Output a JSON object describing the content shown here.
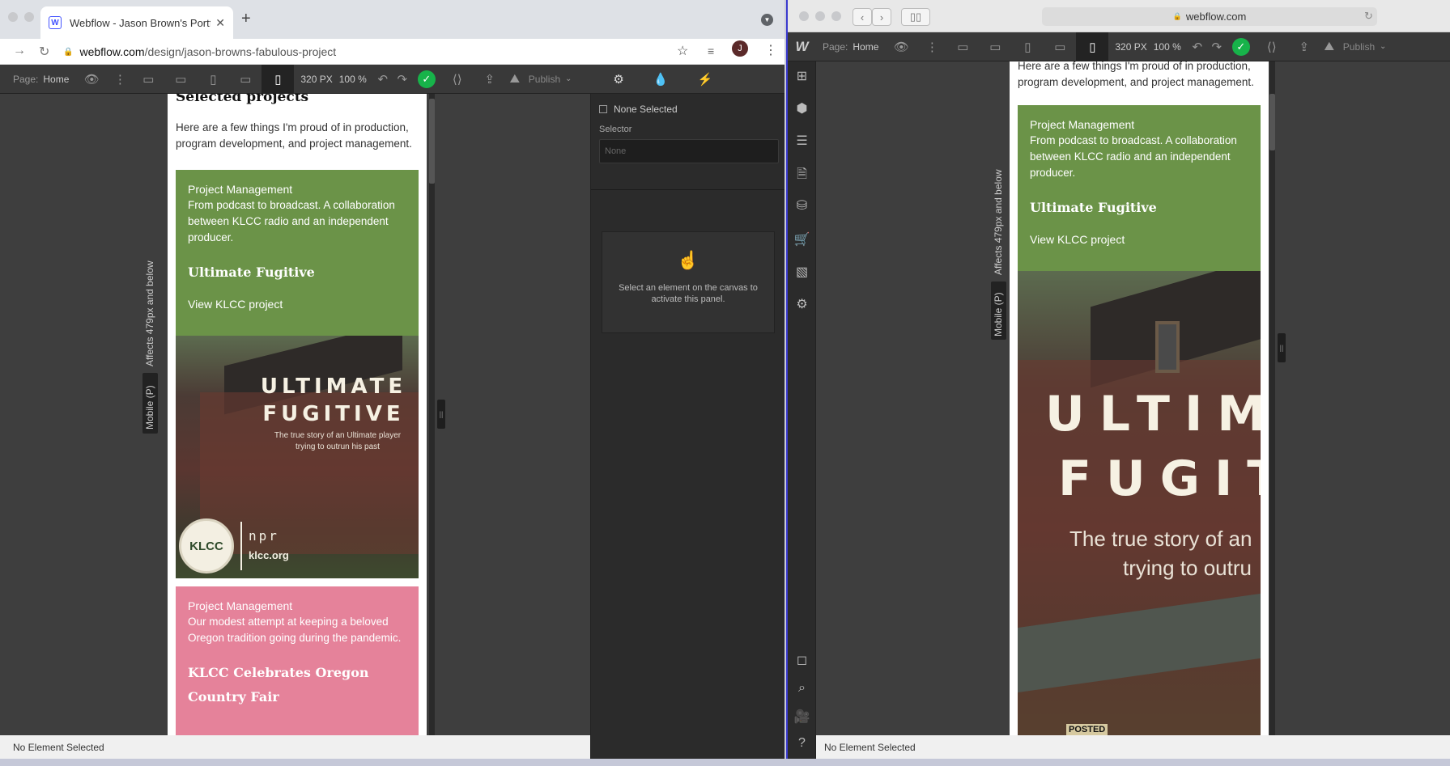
{
  "left_window": {
    "tab_title": "Webflow - Jason Brown's Portf",
    "tab_favicon": "W",
    "url_domain": "webflow.com",
    "url_path": "/design/jason-browns-fabulous-project",
    "avatar_letter": "J"
  },
  "right_window": {
    "url": "webflow.com"
  },
  "designer": {
    "page_label": "Page:",
    "page_name": "Home",
    "width": "320 PX",
    "zoom": "100 %",
    "publish_label": "Publish",
    "breakpoint_label": "Affects 479px and below",
    "breakpoint_device": "Mobile (P)",
    "status": "No Element Selected"
  },
  "style_panel": {
    "selection_label": "None Selected",
    "selector_label": "Selector",
    "selector_placeholder": "None",
    "hint": "Select an element on the canvas to activate this panel."
  },
  "site": {
    "section_title": "Selected projects",
    "intro": "Here are a few things I'm proud of in production, program development, and project management.",
    "projects": [
      {
        "category": "Project Management",
        "description": "From podcast to broadcast. A collaboration between KLCC radio and an independent producer.",
        "title": "Ultimate Fugitive",
        "link": "View KLCC project",
        "color": "#6b9348"
      },
      {
        "category": "Project Management",
        "description": "Our modest attempt at keeping a beloved Oregon tradition going during the pandemic.",
        "title": "KLCC Celebrates Oregon Country Fair",
        "color": "#e5829a"
      }
    ],
    "hero_left": {
      "line1": "ULTIMATE",
      "line2": "FUGITIVE",
      "tagline_1": "The true story of an Ultimate player",
      "tagline_2": "trying to outrun his past",
      "logo_text": "KLCC",
      "npr_text": "npr",
      "klcc_url": "klcc.org"
    },
    "hero_right": {
      "line1": "ULTIM",
      "line2": "FUGIT",
      "tagline_1": "The true story of an",
      "tagline_2": "trying to outru",
      "sign_text": "POSTED"
    }
  },
  "icons": {
    "left_sidebar": [
      "add-icon",
      "cube-icon",
      "navigator-icon",
      "pages-icon",
      "cms-icon",
      "ecommerce-icon",
      "assets-icon",
      "settings-icon",
      "audit-icon",
      "search-icon",
      "video-icon",
      "help-icon"
    ]
  }
}
